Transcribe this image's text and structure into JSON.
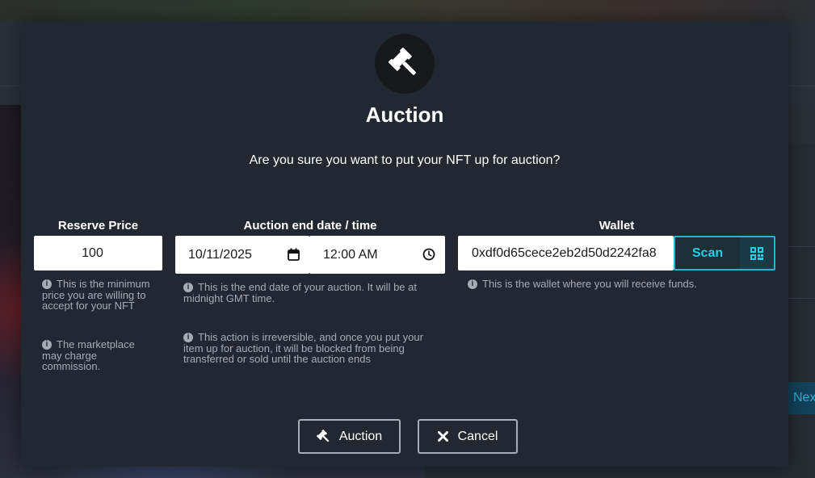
{
  "background": {
    "next_button_label": "Next"
  },
  "modal": {
    "icon": "gavel-icon",
    "title": "Auction",
    "subtitle": "Are you sure you want to put your NFT up for auction?",
    "reserve_price": {
      "label": "Reserve Price",
      "value": "100",
      "hints": [
        "This is the minimum price you are willing to accept for your NFT",
        "The marketplace may charge commission."
      ]
    },
    "end_date": {
      "label": "Auction end date / time",
      "date_value": "10/11/2025",
      "time_value": "12:00 AM",
      "hints": [
        "This is the end date of your auction. It will be at midnight GMT time.",
        "This action is irreversible, and once you put your item up for auction, it will be blocked from being transferred or sold until the auction ends"
      ]
    },
    "wallet": {
      "label": "Wallet",
      "value": "0xdf0d65cece2eb2d50d2242fa8",
      "scan_label": "Scan",
      "hint": "This is the wallet where you will receive funds."
    },
    "buttons": {
      "auction_label": "Auction",
      "cancel_label": "Cancel"
    }
  },
  "colors": {
    "accent": "#1fd0e6",
    "modal_bg": "#222831",
    "hint_text": "#a6acb4"
  }
}
